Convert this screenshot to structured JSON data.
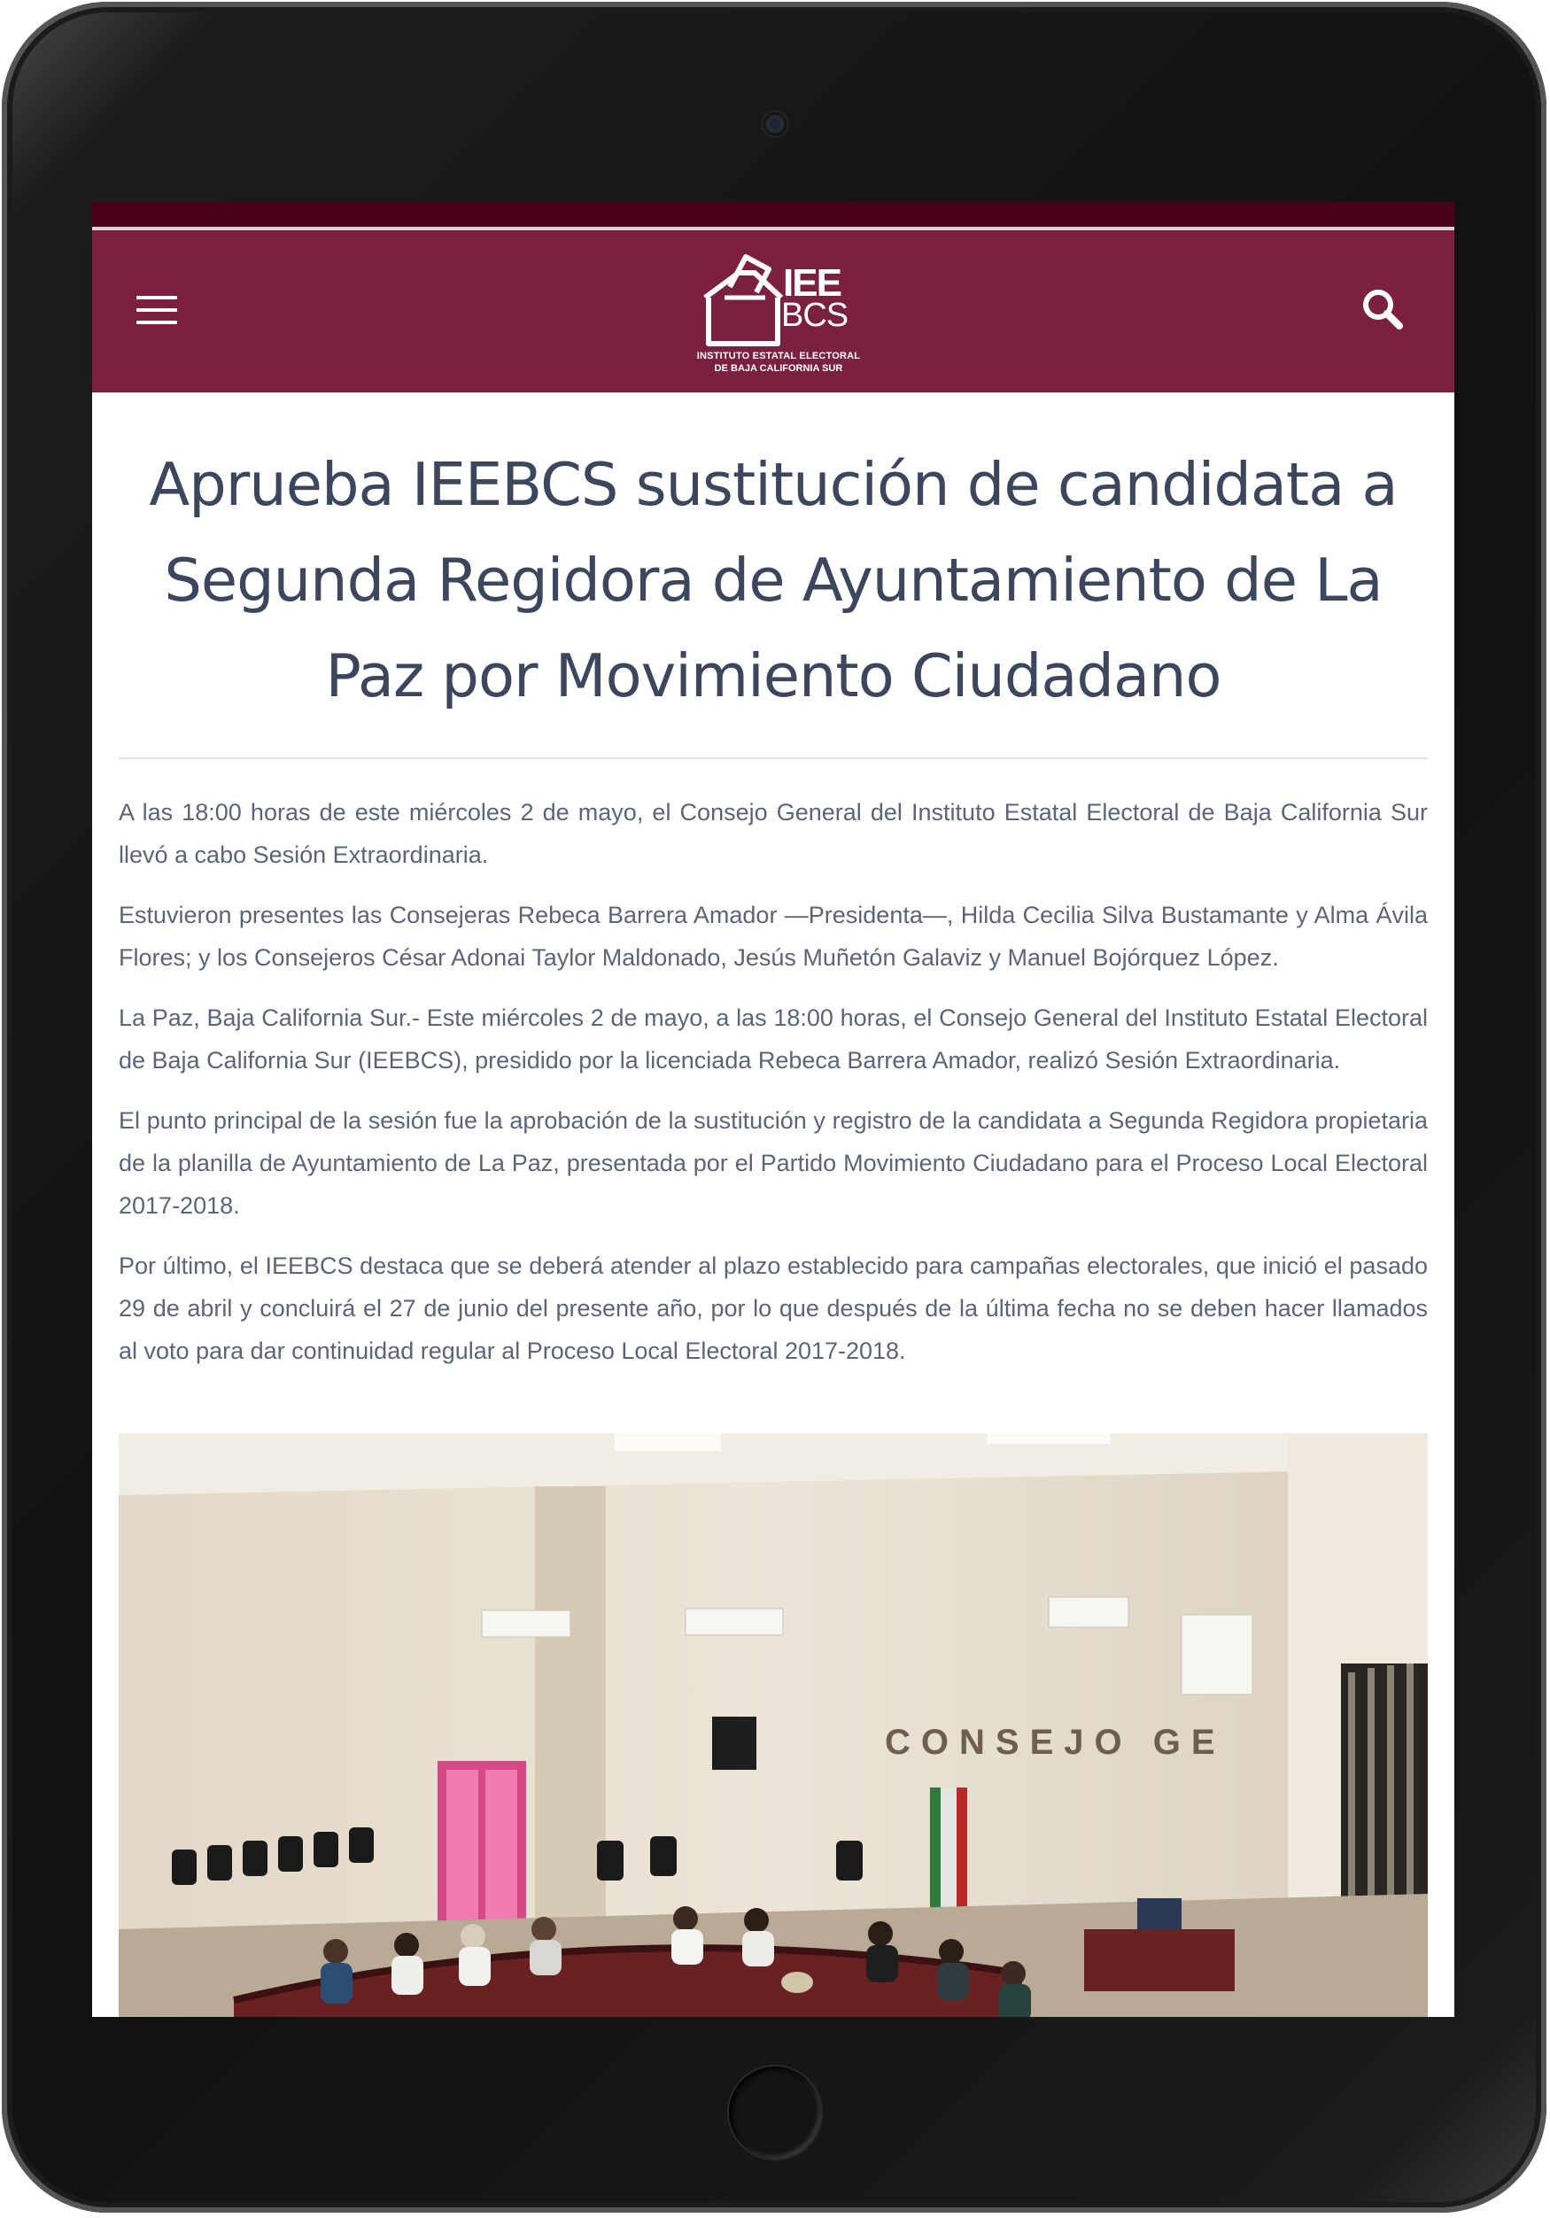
{
  "header": {
    "logo_main": "IEE",
    "logo_sub": "BCS",
    "logo_line1": "INSTITUTO ESTATAL ELECTORAL",
    "logo_line2": "DE BAJA CALIFORNIA SUR",
    "menu_icon": "hamburger-menu-icon",
    "search_icon": "search-icon",
    "accent_color": "#7b2041",
    "topbar_color": "#4a0018"
  },
  "article": {
    "title": "Aprueba IEEBCS sustitución de candidata a Segunda Regidora de Ayuntamiento de La Paz por Movimiento Ciudadano",
    "paragraphs": [
      "A las 18:00 horas de este miércoles 2 de mayo, el Consejo General del Instituto Estatal Electoral de Baja California Sur llevó a cabo Sesión Extraordinaria.",
      "Estuvieron presentes las Consejeras Rebeca Barrera Amador —Presidenta—, Hilda Cecilia Silva Bustamante y Alma Ávila Flores; y los Consejeros César Adonai Taylor Maldonado, Jesús Muñetón Galaviz y Manuel Bojórquez López.",
      "La Paz, Baja California Sur.- Este miércoles 2 de mayo, a las 18:00 horas, el Consejo General del Instituto Estatal Electoral de Baja California Sur (IEEBCS), presidido por la licenciada Rebeca Barrera Amador, realizó Sesión Extraordinaria.",
      "El punto principal de la sesión fue la aprobación de la sustitución y registro de la candidata a Segunda Regidora propietaria de la planilla de Ayuntamiento de La Paz, presentada por el Partido Movimiento Ciudadano para el Proceso Local Electoral 2017-2018.",
      "Por último, el IEEBCS destaca que se deberá atender al plazo establecido para campañas electorales, que inició el pasado 29 de abril y concluirá el 27 de junio del presente año, por lo que después de la última fecha no se deben hacer llamados al voto para dar continuidad regular al Proceso Local Electoral 2017-2018."
    ],
    "photo_wall_text": "CONSEJO GE"
  }
}
